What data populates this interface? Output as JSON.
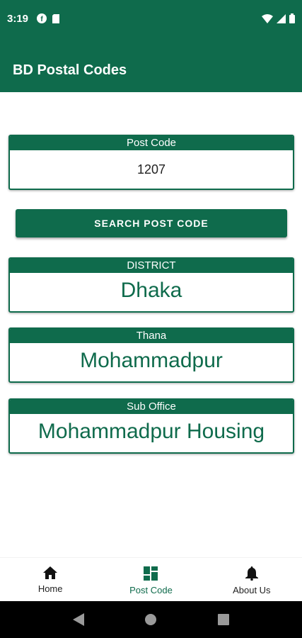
{
  "status_bar": {
    "time": "3:19",
    "left_icons": [
      "fb-icon",
      "sim-icon"
    ],
    "right_icons": [
      "wifi-icon",
      "signal-icon",
      "battery-icon"
    ]
  },
  "app_bar": {
    "title": "BD Postal Codes"
  },
  "post_code_card": {
    "header": "Post Code",
    "value": "1207"
  },
  "search_button": {
    "label": "SEARCH POST CODE"
  },
  "district_card": {
    "header": "DISTRICT",
    "value": "Dhaka"
  },
  "thana_card": {
    "header": "Thana",
    "value": "Mohammadpur"
  },
  "sub_office_card": {
    "header": "Sub Office",
    "value": "Mohammadpur Housing"
  },
  "bottom_nav": {
    "items": [
      {
        "label": "Home",
        "icon": "home-icon",
        "active": false
      },
      {
        "label": "Post Code",
        "icon": "dashboard-icon",
        "active": true
      },
      {
        "label": "About Us",
        "icon": "bell-icon",
        "active": false
      }
    ]
  },
  "system_nav": {
    "buttons": [
      "back-icon",
      "home-circle-icon",
      "recents-icon"
    ]
  },
  "colors": {
    "primary": "#0f6b4c",
    "background": "#ffffff",
    "nav_bar": "#000000"
  }
}
